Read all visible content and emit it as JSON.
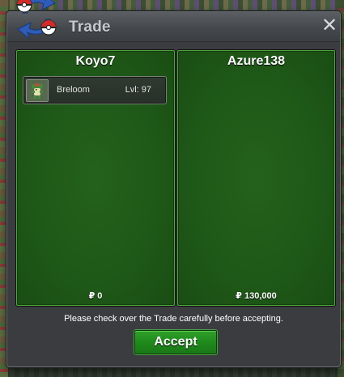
{
  "window": {
    "title": "Trade",
    "close_label": "✕",
    "icon": "trade-pokeball-icon"
  },
  "left_panel": {
    "player_name": "Koyo7",
    "items": [
      {
        "name": "Breloom",
        "level": "Lvl: 97",
        "icon": "breloom-sprite-icon"
      }
    ],
    "money": "₽ 0"
  },
  "right_panel": {
    "player_name": "Azure138",
    "items": [],
    "money": "₽ 130,000"
  },
  "footer": {
    "message": "Please check over the Trade carefully before accepting.",
    "accept_label": "Accept"
  },
  "colors": {
    "panel_green": "#1f5918",
    "panel_border": "#4ea83a",
    "accept_green": "#1f8a1c",
    "window_bg": "#3a3c3f"
  }
}
